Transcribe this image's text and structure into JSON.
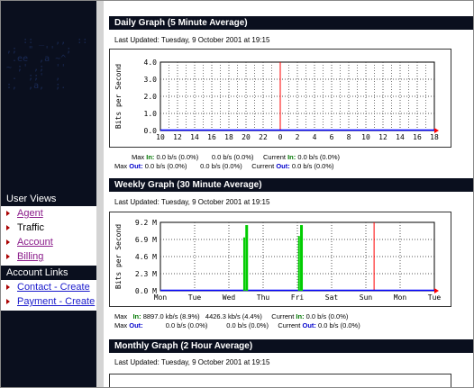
{
  "sidebar": {
    "user_views_heading": "User Views",
    "user_items": [
      {
        "label": "Agent"
      },
      {
        "label": "Traffic"
      },
      {
        "label": "Account"
      },
      {
        "label": "Billing"
      }
    ],
    "account_links_heading": "Account Links",
    "account_items": [
      {
        "label": "Contact - Create"
      },
      {
        "label": "Payment - Create"
      }
    ]
  },
  "daily": {
    "title": "Daily Graph (5 Minute Average)",
    "updated": "Last Updated: Tuesday, 9 October 2001 at 19:15",
    "ylabel": "Bits per Second",
    "yticks": [
      "4.0",
      "3.0",
      "2.0",
      "1.0",
      "0.0"
    ],
    "xticks": [
      "10",
      "12",
      "14",
      "16",
      "18",
      "20",
      "22",
      "0",
      "2",
      "4",
      "6",
      "8",
      "10",
      "12",
      "14",
      "16",
      "18"
    ],
    "stats": {
      "max_label": "Max",
      "in_label": "In:",
      "out_label": "Out:",
      "current_label": "Current",
      "max_in": "0.0 b/s (0.0%)",
      "avg_in": "0.0 b/s (0.0%)",
      "cur_in": "0.0 b/s (0.0%)",
      "max_out": "0.0 b/s (0.0%)",
      "avg_out": "0.0 b/s (0.0%)",
      "cur_out": "0.0 b/s (0.0%)"
    }
  },
  "weekly": {
    "title": "Weekly Graph (30 Minute Average)",
    "updated": "Last Updated: Tuesday, 9 October 2001 at 19:15",
    "ylabel": "Bits per Second",
    "yticks": [
      "9.2 M",
      "6.9 M",
      "4.6 M",
      "2.3 M",
      "0.0 M"
    ],
    "xticks": [
      "Mon",
      "Tue",
      "Wed",
      "Thu",
      "Fri",
      "Sat",
      "Sun",
      "Mon",
      "Tue"
    ],
    "stats": {
      "max_label": "Max",
      "in_label": "In:",
      "out_label": "Out:",
      "current_label": "Current",
      "max_in": "8897.0 kb/s (8.9%)",
      "avg_in": "4426.3 kb/s (4.4%)",
      "cur_in": "0.0 b/s (0.0%)",
      "max_out": "0.0 b/s (0.0%)",
      "avg_out": "0.0 b/s (0.0%)",
      "cur_out": "0.0 b/s (0.0%)"
    }
  },
  "monthly": {
    "title": "Monthly Graph (2 Hour Average)",
    "updated": "Last Updated: Tuesday, 9 October 2001 at 19:15"
  },
  "colors": {
    "header_bg": "#0a0f1e",
    "in_color": "#00cc00",
    "now_line": "#ff0000",
    "out_line": "#0000ff"
  }
}
